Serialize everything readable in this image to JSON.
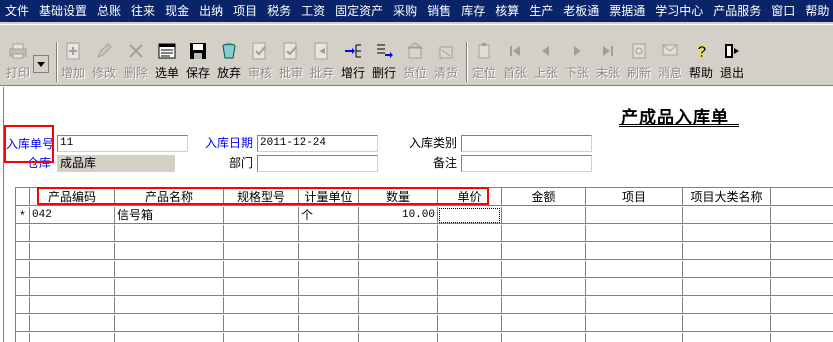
{
  "menu": [
    "文件",
    "基础设置",
    "总账",
    "往来",
    "现金",
    "出纳",
    "项目",
    "税务",
    "工资",
    "固定资产",
    "采购",
    "销售",
    "库存",
    "核算",
    "生产",
    "老板通",
    "票据通",
    "学习中心",
    "产品服务",
    "窗口",
    "帮助"
  ],
  "toolbar": {
    "print": "打印",
    "add": "增加",
    "edit": "修改",
    "delete": "删除",
    "select": "选单",
    "save": "保存",
    "discard": "放弃",
    "audit": "审核",
    "batch_audit": "批审",
    "batch_discard": "批弃",
    "insert_row": "增行",
    "delete_row": "删行",
    "stock_pos": "货位",
    "check": "清货",
    "locate": "定位",
    "first": "首张",
    "prev": "上张",
    "next": "下张",
    "last": "末张",
    "refresh": "刷新",
    "message": "消息",
    "help": "帮助",
    "exit": "退出"
  },
  "form": {
    "title": "产成品入库单",
    "doc_no_label": "入库单号",
    "doc_no_value": "11",
    "date_label": "入库日期",
    "date_value": "2011-12-24",
    "type_label": "入库类别",
    "type_value": "",
    "warehouse_label": "仓库",
    "warehouse_value": "成品库",
    "dept_label": "部门",
    "dept_value": "",
    "remark_label": "备注",
    "remark_value": ""
  },
  "grid": {
    "headers": [
      "产品编码",
      "产品名称",
      "规格型号",
      "计量单位",
      "数量",
      "单价",
      "金额",
      "项目",
      "项目大类名称"
    ],
    "rows": [
      {
        "marker": "*",
        "code": "042",
        "name": "信号箱",
        "spec": "",
        "unit": "个",
        "qty": "10.00",
        "price": "",
        "amount": "",
        "project": "",
        "category": ""
      }
    ]
  },
  "colors": {
    "menubar_bg": "#0a246a",
    "toolbar_bg": "#d4d0c8",
    "label_blue": "#0000ff",
    "annotation_red": "#ff0000"
  }
}
